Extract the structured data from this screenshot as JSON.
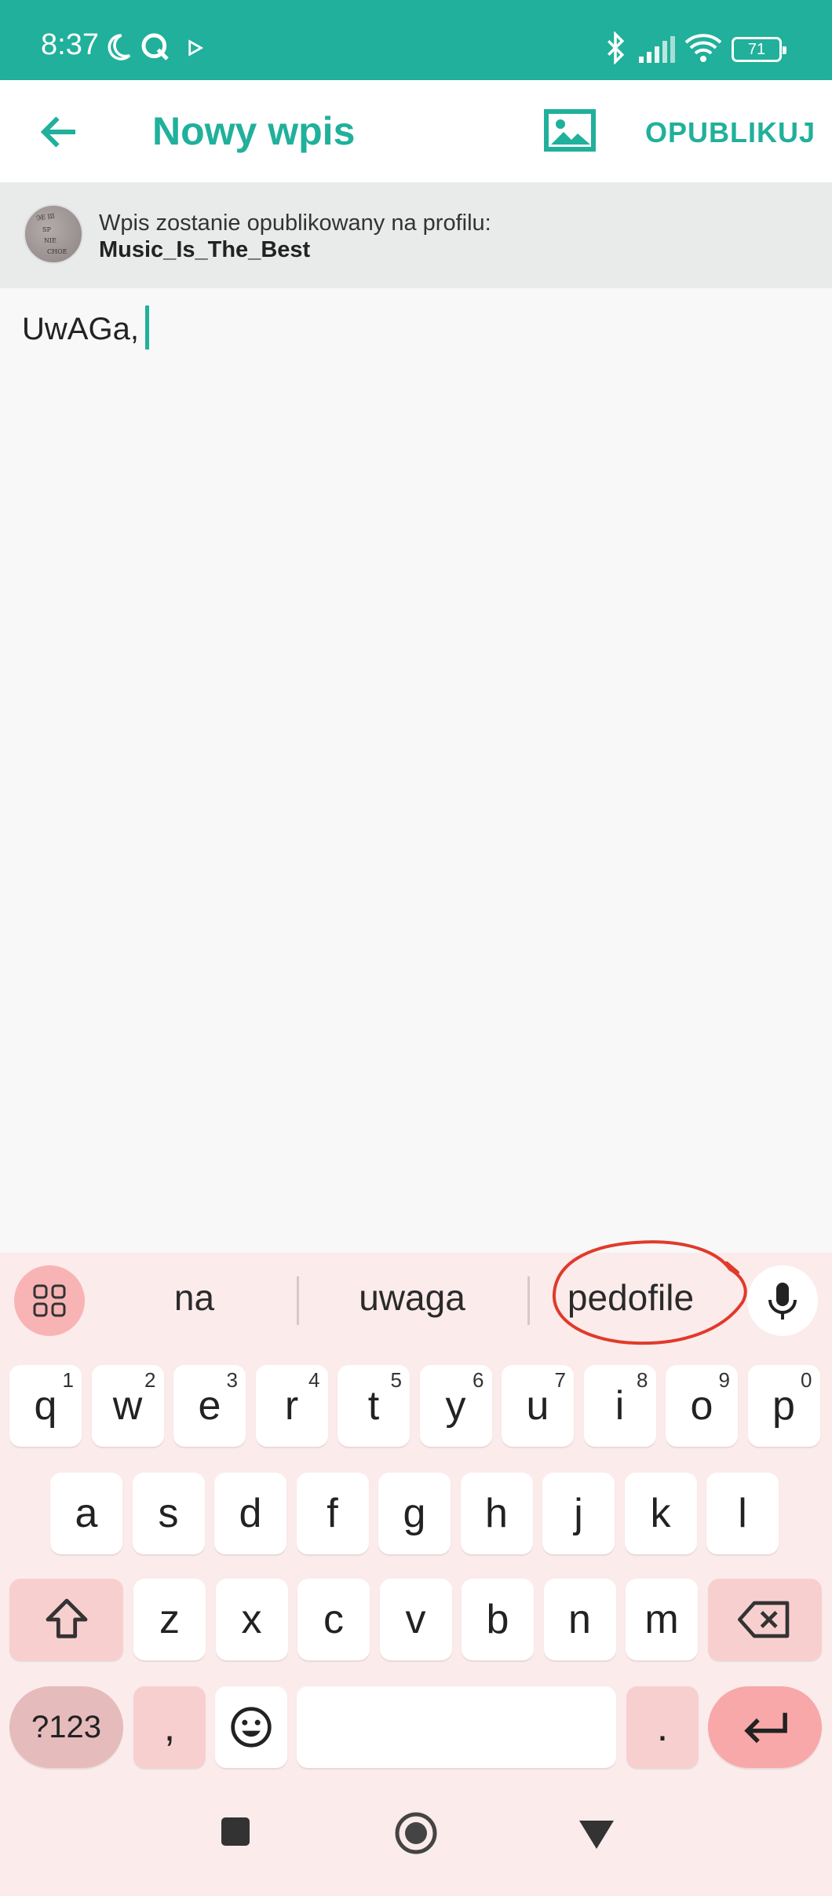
{
  "status_bar": {
    "time": "8:37",
    "battery": "71"
  },
  "app_bar": {
    "title": "Nowy wpis",
    "publish_label": "OPUBLIKUJ"
  },
  "banner": {
    "line1": "Wpis zostanie opublikowany na profilu:",
    "profile_name": "Music_Is_The_Best"
  },
  "editor": {
    "text": "UwAGa,"
  },
  "keyboard": {
    "suggestions": [
      "na",
      "uwaga",
      "pedofile"
    ],
    "row1": [
      {
        "letter": "q",
        "num": "1"
      },
      {
        "letter": "w",
        "num": "2"
      },
      {
        "letter": "e",
        "num": "3"
      },
      {
        "letter": "r",
        "num": "4"
      },
      {
        "letter": "t",
        "num": "5"
      },
      {
        "letter": "y",
        "num": "6"
      },
      {
        "letter": "u",
        "num": "7"
      },
      {
        "letter": "i",
        "num": "8"
      },
      {
        "letter": "o",
        "num": "9"
      },
      {
        "letter": "p",
        "num": "0"
      }
    ],
    "row2": [
      "a",
      "s",
      "d",
      "f",
      "g",
      "h",
      "j",
      "k",
      "l"
    ],
    "row3": [
      "z",
      "x",
      "c",
      "v",
      "b",
      "n",
      "m"
    ],
    "sym_label": "?123",
    "comma_label": ",",
    "period_label": "."
  },
  "colors": {
    "accent": "#20b09b",
    "annotation": "#e03a2a",
    "keyboard_bg": "#fcebeb"
  }
}
